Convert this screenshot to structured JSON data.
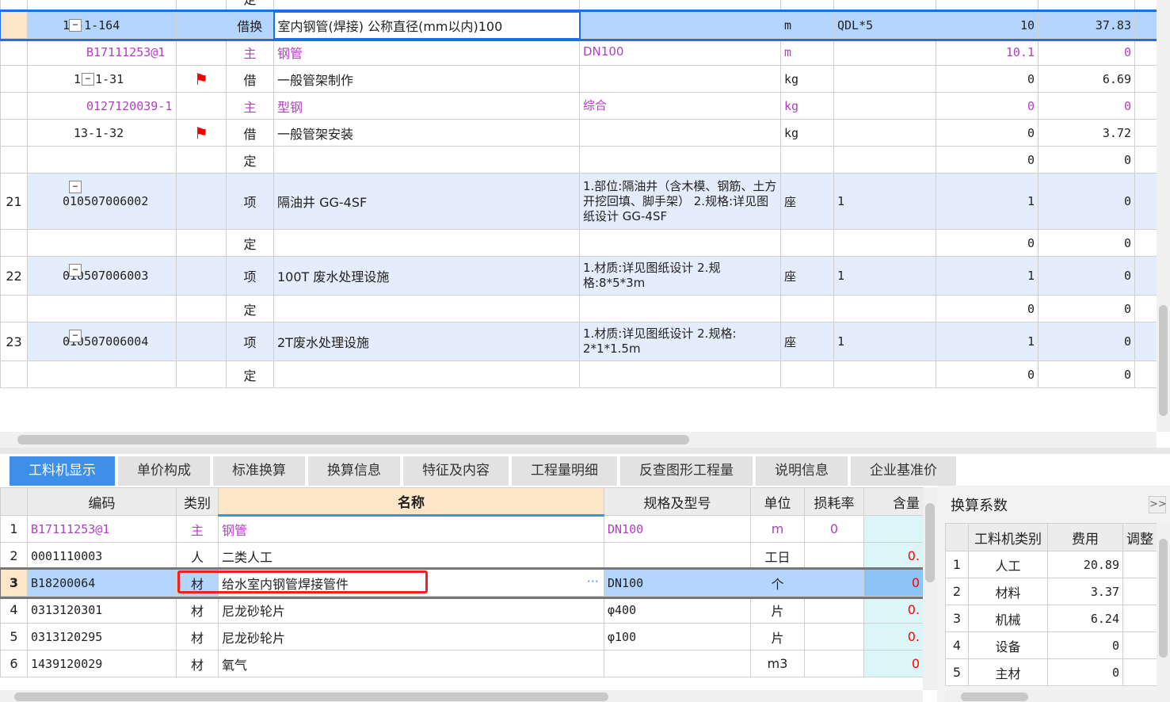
{
  "top_grid": {
    "rows": [
      {
        "num": "",
        "code": "",
        "level": 0,
        "tree": "",
        "flag": false,
        "type": "借换",
        "name": "室内钢管(焊接) 公称直径(mm以内)100",
        "feature": "",
        "unit": "m",
        "expr": "QDL*5",
        "qty": "10",
        "price": "37.83",
        "selected": true,
        "code_text": "10-1-164",
        "box": true
      },
      {
        "num": "",
        "code_text": "B17111253@1",
        "level": 2,
        "flag": false,
        "type": "主",
        "name": "钢管",
        "feature": "DN100",
        "unit": "m",
        "expr": "",
        "qty": "10.1",
        "price": "0",
        "purple": true
      },
      {
        "num": "",
        "code_text": "13-1-31",
        "level": 1,
        "flag": true,
        "box": true,
        "type": "借",
        "name": "一般管架制作",
        "feature": "",
        "unit": "kg",
        "expr": "",
        "qty": "0",
        "price": "6.69"
      },
      {
        "num": "",
        "code_text": "0127120039-1",
        "level": 2,
        "flag": false,
        "type": "主",
        "name": "型钢",
        "feature": "综合",
        "unit": "kg",
        "expr": "",
        "qty": "0",
        "price": "0",
        "purple": true
      },
      {
        "num": "",
        "code_text": "13-1-32",
        "level": 1,
        "flag": true,
        "type": "借",
        "name": "一般管架安装",
        "feature": "",
        "unit": "kg",
        "expr": "",
        "qty": "0",
        "price": "3.72"
      },
      {
        "num": "",
        "code_text": "",
        "level": 1,
        "flag": false,
        "type": "定",
        "name": "",
        "feature": "",
        "unit": "",
        "expr": "",
        "qty": "0",
        "price": "0"
      },
      {
        "num": "21",
        "code_text": "010507006002",
        "level": 0,
        "box": true,
        "flag": false,
        "type": "项",
        "name": "隔油井 GG-4SF",
        "feature": "1.部位:隔油井（含木模、钢筋、土方开挖回填、脚手架）\n2.规格:详见图纸设计 GG-4SF",
        "unit": "座",
        "expr": "1",
        "qty": "1",
        "price": "0",
        "highlight": true,
        "tall": 3
      },
      {
        "num": "",
        "code_text": "",
        "level": 0,
        "flag": false,
        "type": "定",
        "name": "",
        "feature": "",
        "unit": "",
        "expr": "",
        "qty": "0",
        "price": "0"
      },
      {
        "num": "22",
        "code_text": "010507006003",
        "level": 0,
        "box": true,
        "flag": false,
        "type": "项",
        "name": "100T 废水处理设施",
        "feature": "1.材质:详见图纸设计\n2.规格:8*5*3m",
        "unit": "座",
        "expr": "1",
        "qty": "1",
        "price": "0",
        "highlight": true,
        "tall": 2
      },
      {
        "num": "",
        "code_text": "",
        "level": 0,
        "flag": false,
        "type": "定",
        "name": "",
        "feature": "",
        "unit": "",
        "expr": "",
        "qty": "0",
        "price": "0"
      },
      {
        "num": "23",
        "code_text": "010507006004",
        "level": 0,
        "box": true,
        "flag": false,
        "type": "项",
        "name": "2T废水处理设施",
        "feature": "1.材质:详见图纸设计\n2.规格: 2*1*1.5m",
        "unit": "座",
        "expr": "1",
        "qty": "1",
        "price": "0",
        "highlight": true,
        "tall": 2
      },
      {
        "num": "",
        "code_text": "",
        "level": 0,
        "flag": false,
        "type": "定",
        "name": "",
        "feature": "",
        "unit": "",
        "expr": "",
        "qty": "0",
        "price": "0"
      }
    ]
  },
  "tabs": [
    "工料机显示",
    "单价构成",
    "标准换算",
    "换算信息",
    "特征及内容",
    "工程量明细",
    "反查图形工程量",
    "说明信息",
    "企业基准价"
  ],
  "bottom_grid": {
    "headers": [
      "",
      "编码",
      "类别",
      "名称",
      "规格及型号",
      "单位",
      "损耗率",
      "含量"
    ],
    "rows": [
      {
        "num": "1",
        "code": "B17111253@1",
        "type": "主",
        "name": "钢管",
        "spec": "DN100",
        "unit": "m",
        "loss": "0",
        "amount": "",
        "purple": true
      },
      {
        "num": "2",
        "code": "0001110003",
        "type": "人",
        "name": "二类人工",
        "spec": "",
        "unit": "工日",
        "loss": "",
        "amount": "0."
      },
      {
        "num": "3",
        "code": "B18200064",
        "type": "材",
        "name": "给水室内钢管焊接管件",
        "spec": "DN100",
        "unit": "个",
        "loss": "",
        "amount": "0",
        "selected": true
      },
      {
        "num": "4",
        "code": "0313120301",
        "type": "材",
        "name": "尼龙砂轮片",
        "spec": "φ400",
        "unit": "片",
        "loss": "",
        "amount": "0."
      },
      {
        "num": "5",
        "code": "0313120295",
        "type": "材",
        "name": "尼龙砂轮片",
        "spec": "φ100",
        "unit": "片",
        "loss": "",
        "amount": "0."
      },
      {
        "num": "6",
        "code": "1439120029",
        "type": "材",
        "name": "氧气",
        "spec": "",
        "unit": "m3",
        "loss": "",
        "amount": "0"
      }
    ]
  },
  "side_panel": {
    "title": "换算系数",
    "headers": [
      "",
      "工料机类别",
      "费用",
      "调整"
    ],
    "rows": [
      {
        "num": "1",
        "cat": "人工",
        "fee": "20.89"
      },
      {
        "num": "2",
        "cat": "材料",
        "fee": "3.37"
      },
      {
        "num": "3",
        "cat": "机械",
        "fee": "6.24"
      },
      {
        "num": "4",
        "cat": "设备",
        "fee": "0"
      },
      {
        "num": "5",
        "cat": "主材",
        "fee": "0"
      }
    ]
  },
  "colors": {
    "accent": "#3d8fe8",
    "selection": "#b4d5fd",
    "flag": "#f00000",
    "main_material": "#b040c0",
    "highlight_box": "#f02020"
  }
}
